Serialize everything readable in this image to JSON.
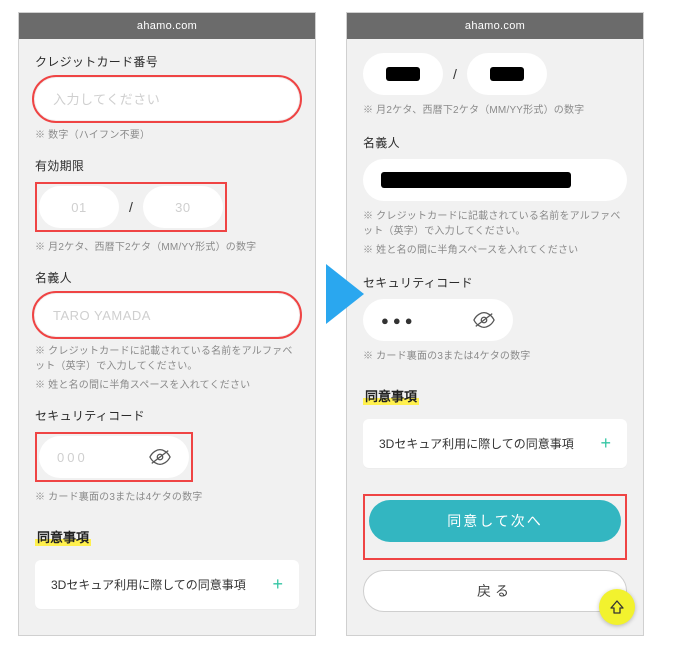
{
  "urlbar": "ahamo.com",
  "left": {
    "card_number_label": "クレジットカード番号",
    "card_number_placeholder": "入力してください",
    "card_number_note": "※ 数字（ハイフン不要）",
    "expiry_label": "有効期限",
    "expiry_mm": "01",
    "expiry_yy": "30",
    "expiry_note": "※ 月2ケタ、西暦下2ケタ（MM/YY形式）の数字",
    "holder_label": "名義人",
    "holder_placeholder": "TARO YAMADA",
    "holder_note1": "※ クレジットカードに記載されている名前をアルファベット（英字）で入力してください。",
    "holder_note2": "※ 姓と名の間に半角スペースを入れてください",
    "security_label": "セキュリティコード",
    "security_placeholder": "000",
    "security_note": "※ カード裏面の3または4ケタの数字",
    "consent_heading": "同意事項",
    "consent_item": "3Dセキュア利用に際しての同意事項"
  },
  "right": {
    "expiry_note": "※ 月2ケタ、西暦下2ケタ（MM/YY形式）の数字",
    "holder_label": "名義人",
    "holder_note1": "※ クレジットカードに記載されている名前をアルファベット（英字）で入力してください。",
    "holder_note2": "※ 姓と名の間に半角スペースを入れてください",
    "security_label": "セキュリティコード",
    "security_masked": "●●●",
    "security_note": "※ カード裏面の3または4ケタの数字",
    "consent_heading": "同意事項",
    "consent_item": "3Dセキュア利用に際しての同意事項",
    "agree_btn": "同意して次へ",
    "back_btn": "戻る"
  },
  "slash": "/"
}
